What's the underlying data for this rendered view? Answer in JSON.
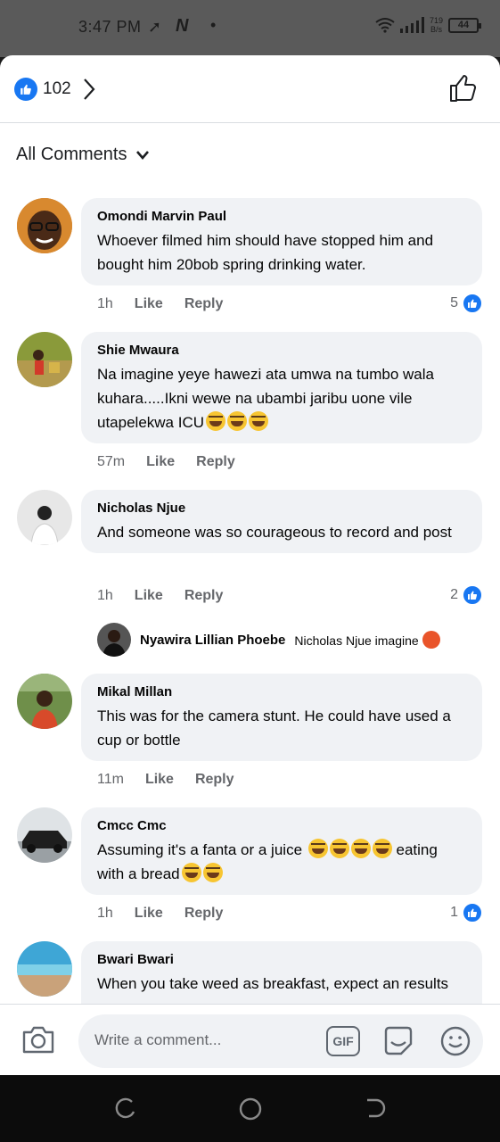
{
  "status_bar": {
    "time": "3:47 PM",
    "net_speed_value": "719",
    "net_speed_unit": "B/s",
    "battery": "44"
  },
  "header": {
    "reaction_count": "102"
  },
  "sort": {
    "label": "All Comments"
  },
  "comments": [
    {
      "name": "Omondi Marvin Paul",
      "text": "Whoever filmed him should have stopped him and bought him 20bob spring drinking water.",
      "time": "1h",
      "like_label": "Like",
      "reply_label": "Reply",
      "likes": "5"
    },
    {
      "name": "Shie Mwaura",
      "text": "Na imagine yeye hawezi ata umwa na tumbo wala kuhara.....Ikni wewe na ubambi jaribu uone vile utapelekwa ICU",
      "time": "57m",
      "like_label": "Like",
      "reply_label": "Reply"
    },
    {
      "name": "Nicholas Njue",
      "text": "And someone was so courageous to record and post",
      "time": "1h",
      "like_label": "Like",
      "reply_label": "Reply",
      "likes": "2"
    },
    {
      "name": "Mikal Millan",
      "text": "This was for the camera stunt. He could have used a cup or bottle",
      "time": "11m",
      "like_label": "Like",
      "reply_label": "Reply"
    },
    {
      "name": "Cmcc Cmc",
      "text_a": "Assuming it's a fanta or a juice",
      "text_b": "eating with a bread",
      "time": "1h",
      "like_label": "Like",
      "reply_label": "Reply",
      "likes": "1"
    },
    {
      "name": "Bwari Bwari",
      "text": "When you take weed as breakfast, expect an results"
    }
  ],
  "reply": {
    "name": "Nyawira Lillian Phoebe",
    "text": "Nicholas Njue imagine"
  },
  "composer": {
    "placeholder": "Write a comment...",
    "gif_label": "GIF"
  },
  "colors": {
    "accent": "#1877f2",
    "bubble": "#f0f2f5",
    "meta": "#65676b"
  }
}
